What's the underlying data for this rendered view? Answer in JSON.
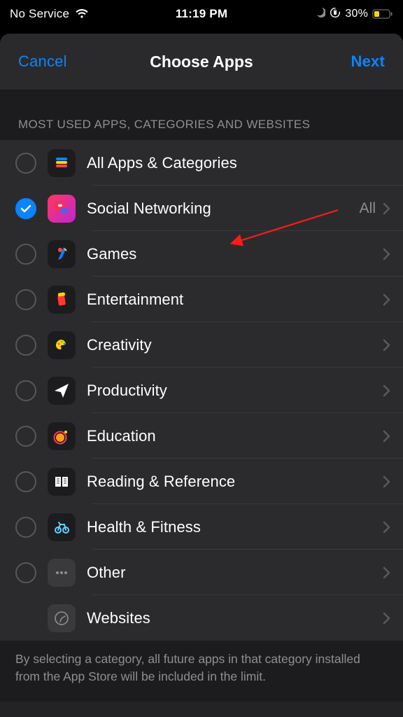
{
  "status_bar": {
    "carrier": "No Service",
    "time": "11:19 PM",
    "battery_pct": "30%"
  },
  "nav": {
    "cancel": "Cancel",
    "title": "Choose Apps",
    "next": "Next"
  },
  "section_header": "MOST USED APPS, CATEGORIES AND WEBSITES",
  "rows": [
    {
      "icon": "stack-icon",
      "label": "All Apps & Categories",
      "checked": false,
      "chevron": false,
      "detail": ""
    },
    {
      "icon": "social-icon",
      "label": "Social Networking",
      "checked": true,
      "chevron": true,
      "detail": "All"
    },
    {
      "icon": "games-icon",
      "label": "Games",
      "checked": false,
      "chevron": true,
      "detail": ""
    },
    {
      "icon": "entertain-icon",
      "label": "Entertainment",
      "checked": false,
      "chevron": true,
      "detail": ""
    },
    {
      "icon": "creativity-icon",
      "label": "Creativity",
      "checked": false,
      "chevron": true,
      "detail": ""
    },
    {
      "icon": "productivity-icon",
      "label": "Productivity",
      "checked": false,
      "chevron": true,
      "detail": ""
    },
    {
      "icon": "education-icon",
      "label": "Education",
      "checked": false,
      "chevron": true,
      "detail": ""
    },
    {
      "icon": "reading-icon",
      "label": "Reading & Reference",
      "checked": false,
      "chevron": true,
      "detail": ""
    },
    {
      "icon": "health-icon",
      "label": "Health & Fitness",
      "checked": false,
      "chevron": true,
      "detail": ""
    },
    {
      "icon": "other-icon",
      "label": "Other",
      "checked": false,
      "chevron": true,
      "detail": ""
    },
    {
      "icon": "websites-icon",
      "label": "Websites",
      "checked": null,
      "chevron": true,
      "detail": ""
    }
  ],
  "footer_note": "By selecting a category, all future apps in that category installed from the App Store will be included in the limit."
}
